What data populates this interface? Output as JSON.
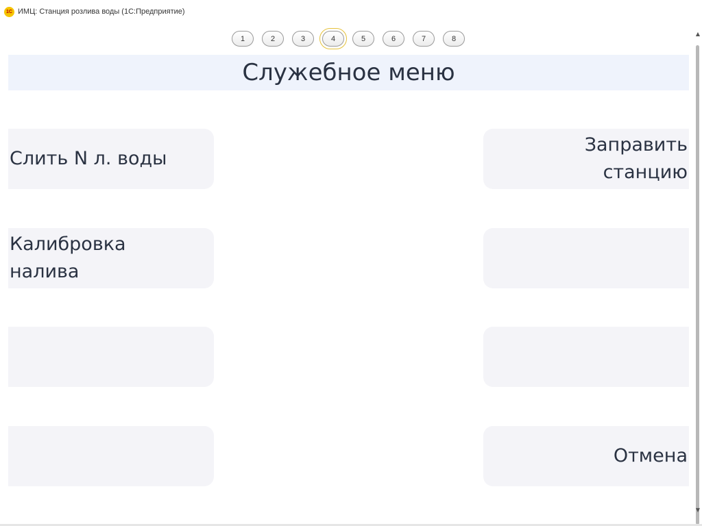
{
  "window": {
    "title": "ИМЦ: Станция розлива воды  (1С:Предприятие)",
    "logo_text": "1С"
  },
  "pager": {
    "pages": [
      "1",
      "2",
      "3",
      "4",
      "5",
      "6",
      "7",
      "8"
    ],
    "current": "4"
  },
  "header": {
    "title": "Служебное меню"
  },
  "tiles": {
    "left": [
      {
        "label": "Слить N л. воды"
      },
      {
        "label": "Калибровка\nналива"
      },
      {
        "label": ""
      },
      {
        "label": ""
      }
    ],
    "right": [
      {
        "label": "Заправить\nстанцию"
      },
      {
        "label": ""
      },
      {
        "label": ""
      },
      {
        "label": "Отмена"
      }
    ]
  },
  "colors": {
    "header_bg": "#eff3fc",
    "tile_bg": "#f4f4f8",
    "text": "#2a3242",
    "focus_frame": "#e5c13a"
  }
}
